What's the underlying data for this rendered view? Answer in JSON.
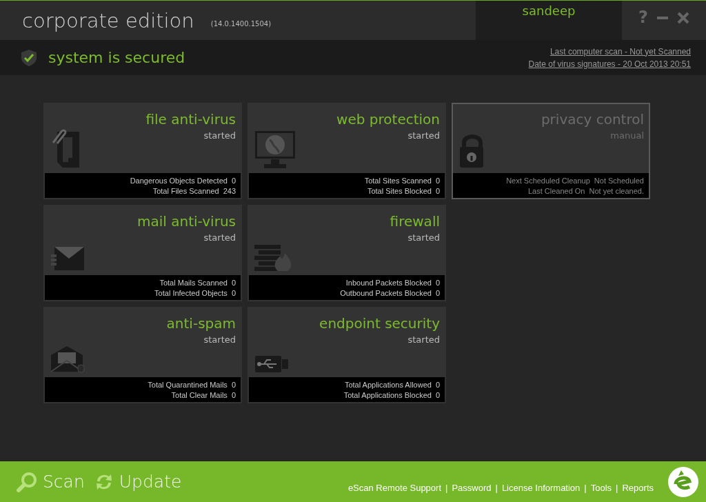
{
  "header": {
    "title": "corporate edition",
    "version": "(14.0.1400.1504)",
    "user": "sandeep",
    "controls": [
      {
        "kind": "help",
        "label": "?"
      },
      {
        "kind": "minimize"
      },
      {
        "kind": "close"
      }
    ]
  },
  "status": {
    "secured": true,
    "message": "system is secured",
    "links": [
      "Last computer scan - Not yet Scanned",
      "Date of  virus signatures - 20 Oct 2013 20:51"
    ]
  },
  "tile_columns": [
    [
      {
        "kind": "file",
        "title": "file anti-virus",
        "state": "started",
        "active": true,
        "selected": false,
        "stats": [
          {
            "label": "Dangerous Objects Detected",
            "value": "0"
          },
          {
            "label": "Total Files Scanned",
            "value": "243"
          }
        ]
      },
      {
        "kind": "mail",
        "title": "mail anti-virus",
        "state": "started",
        "active": true,
        "selected": false,
        "stats": [
          {
            "label": "Total Mails Scanned",
            "value": "0"
          },
          {
            "label": "Total Infected Objects",
            "value": "0"
          }
        ]
      },
      {
        "kind": "spam",
        "title": "anti-spam",
        "state": "started",
        "active": true,
        "selected": false,
        "stats": [
          {
            "label": "Total Quarantined Mails",
            "value": "0"
          },
          {
            "label": "Total Clear Mails",
            "value": "0"
          }
        ]
      }
    ],
    [
      {
        "kind": "web",
        "title": "web protection",
        "state": "started",
        "active": true,
        "selected": false,
        "stats": [
          {
            "label": "Total Sites Scanned",
            "value": "0"
          },
          {
            "label": "Total Sites Blocked",
            "value": "0"
          }
        ]
      },
      {
        "kind": "firewall",
        "title": "firewall",
        "state": "started",
        "active": true,
        "selected": false,
        "stats": [
          {
            "label": "Inbound Packets Blocked",
            "value": "0"
          },
          {
            "label": "Outbound Packets Blocked",
            "value": "0"
          }
        ]
      },
      {
        "kind": "usb",
        "title": "endpoint security",
        "state": "started",
        "active": true,
        "selected": false,
        "stats": [
          {
            "label": "Total Applications Allowed",
            "value": "0"
          },
          {
            "label": "Total Applications Blocked",
            "value": "0"
          }
        ]
      }
    ],
    [
      {
        "kind": "privacy",
        "title": "privacy control",
        "state": "manual",
        "active": false,
        "selected": true,
        "stats": [
          {
            "label": "Next Scheduled Cleanup",
            "value": "Not Scheduled"
          },
          {
            "label": "Last Cleaned On",
            "value": "Not yet cleaned."
          }
        ]
      }
    ]
  ],
  "footer": {
    "actions": [
      {
        "kind": "scan",
        "label": "Scan"
      },
      {
        "kind": "update",
        "label": "Update"
      }
    ],
    "links": [
      "eScan Remote Support",
      "Password",
      "License Information",
      "Tools",
      "Reports"
    ],
    "separator": "|"
  }
}
